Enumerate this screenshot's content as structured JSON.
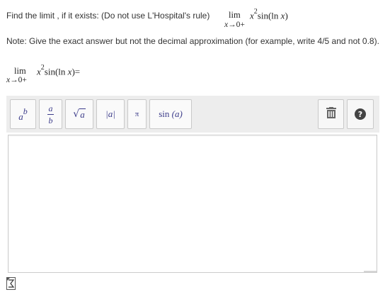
{
  "question": {
    "prompt": "Find the limit , if it exists: (Do not use L'Hospital's rule)",
    "limit": {
      "word": "lim",
      "sub_var": "x",
      "sub_arrow": "→0+",
      "expr_base": "x",
      "expr_power": "2",
      "expr_rest": "sin(ln",
      "expr_var": "x",
      "expr_close": ")"
    }
  },
  "note": "Note: Give the exact answer but not the decimal approximation (for example, write 4/5 and not 0.8).",
  "answer_line": {
    "word": "lim",
    "sub_var": "x",
    "sub_arrow": "→0+",
    "expr_base": "x",
    "expr_power": "2",
    "expr_rest": "sin(ln",
    "expr_var": "x",
    "expr_close": ")=",
    "answer_value": ""
  },
  "toolbar": {
    "exponent": {
      "base": "a",
      "sup": "b"
    },
    "fraction": {
      "num": "a",
      "den": "b"
    },
    "sqrt": {
      "symbol": "√",
      "arg": "a"
    },
    "abs": {
      "text": "|a|"
    },
    "pi": {
      "text": "π"
    },
    "sin": {
      "fn": "sin",
      "arg": "(a)"
    },
    "trash_label": "",
    "help_label": "?"
  },
  "colors": {
    "toolbar_bg": "#ededed",
    "button_text": "#3c3c8a",
    "help_bg": "#444444"
  },
  "icons": {
    "trash": "trash-icon",
    "help": "help-icon",
    "equation_editor": "equation-editor-icon"
  }
}
